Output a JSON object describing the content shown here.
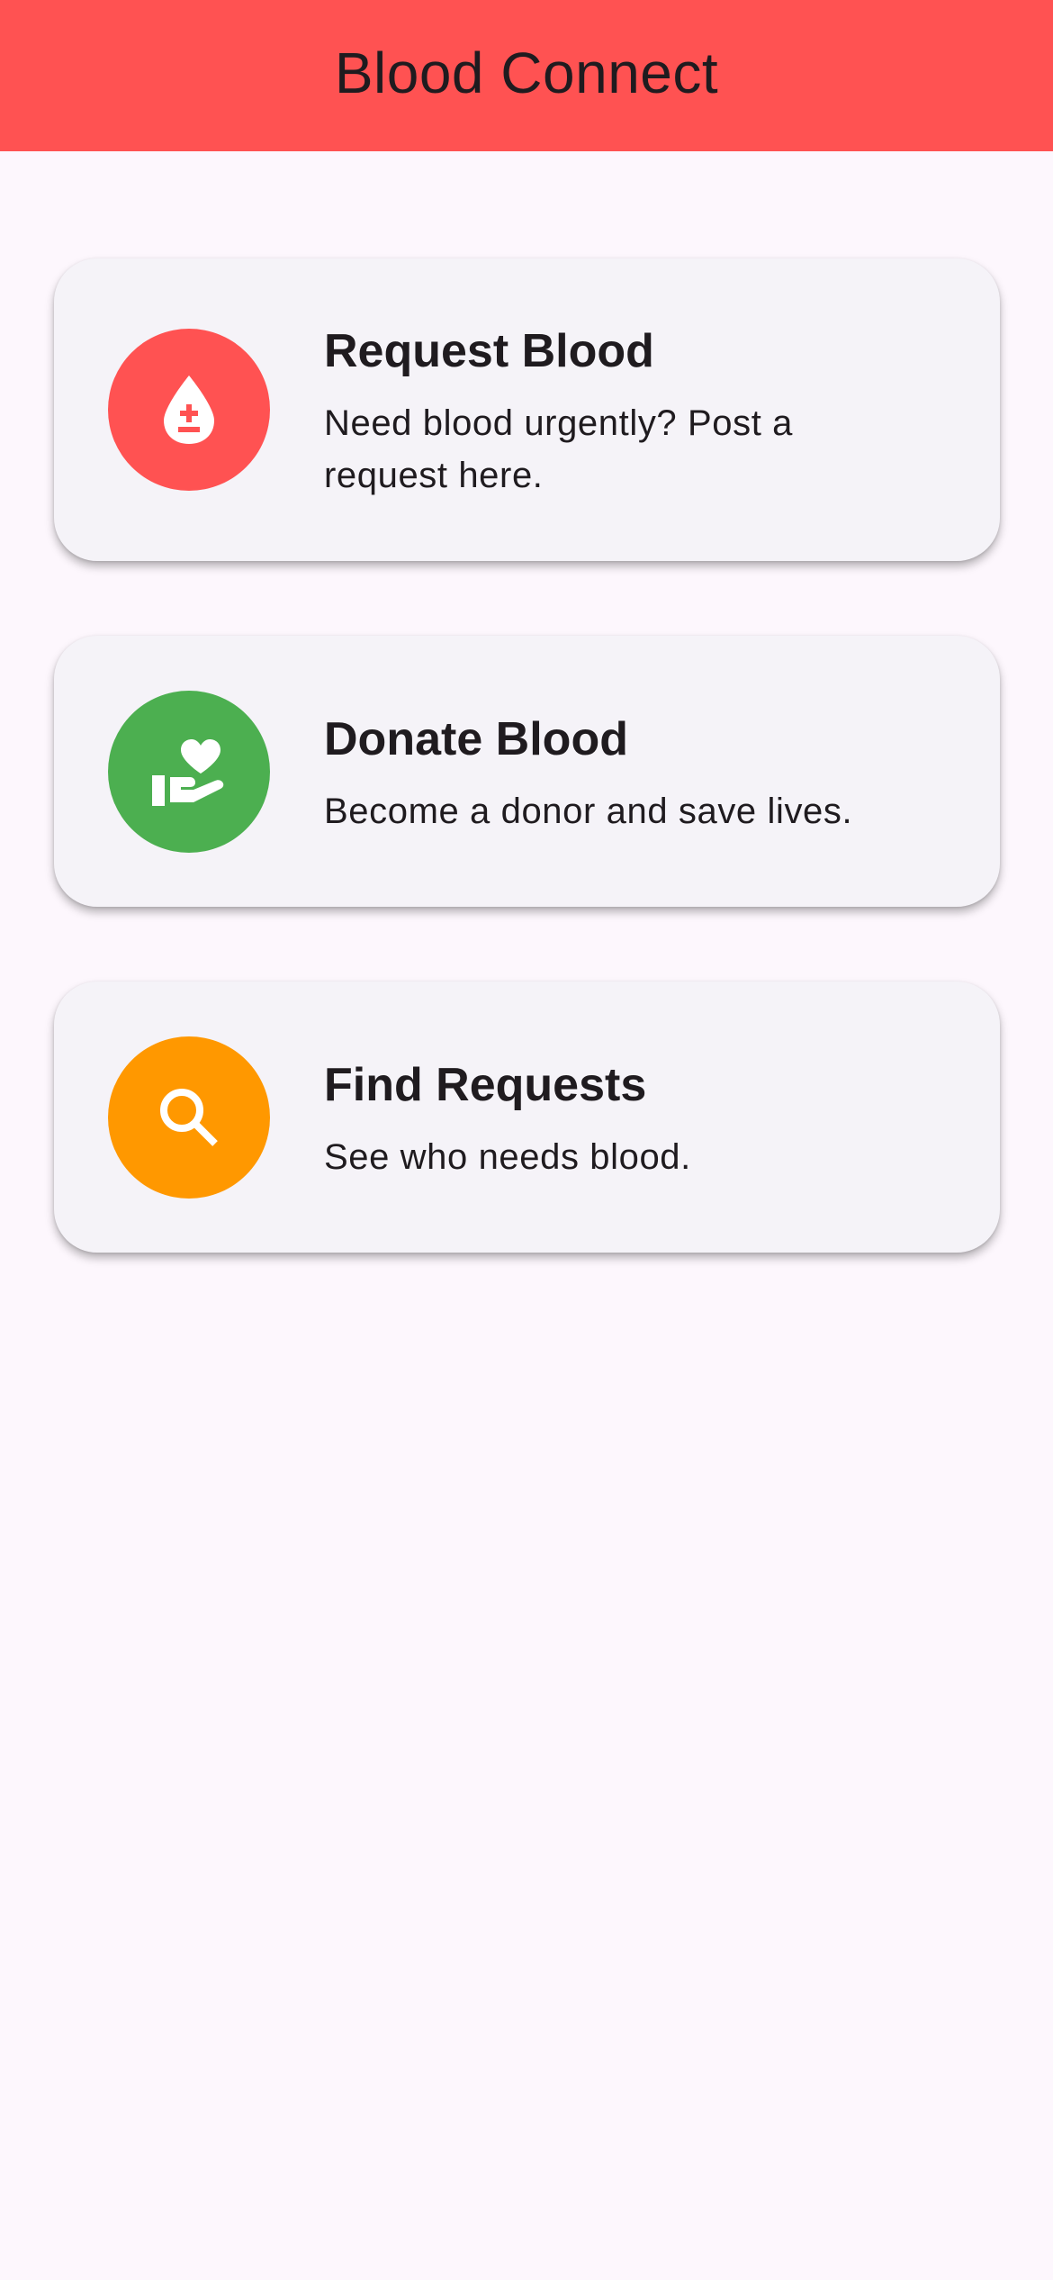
{
  "app": {
    "title": "Blood Connect",
    "bar_color": "#FF5252",
    "background": "#FDF7FD"
  },
  "cards": [
    {
      "id": "request",
      "title": "Request Blood",
      "subtitle": "Need blood urgently? Post a request here.",
      "icon": "blood-drop-plus-minus-icon",
      "color": "#FF5252"
    },
    {
      "id": "donate",
      "title": "Donate Blood",
      "subtitle": "Become a donor and save lives.",
      "icon": "hand-heart-icon",
      "color": "#4CAF50"
    },
    {
      "id": "find",
      "title": "Find Requests",
      "subtitle": "See who needs blood.",
      "icon": "search-icon",
      "color": "#FF9800"
    }
  ]
}
